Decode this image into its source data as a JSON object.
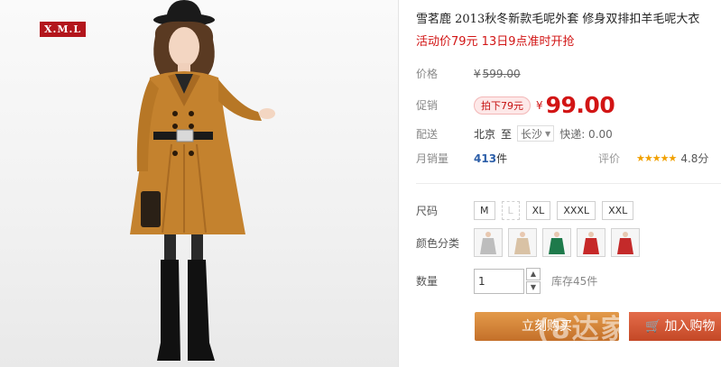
{
  "brand": {
    "logo_text": "X.M.L"
  },
  "product": {
    "title_prefix": "雪茗鹿 ",
    "title_year": "2013",
    "title_rest": "秋冬新款毛呢外套 修身双排扣羊毛呢大衣",
    "promo": "活动价79元 13日9点准时开抢"
  },
  "price_row": {
    "label": "价格",
    "symbol": "¥",
    "original": "599.00"
  },
  "promo_row": {
    "label": "促销",
    "badge": "拍下79元",
    "symbol": "¥",
    "price": "99.00"
  },
  "delivery": {
    "label": "配送",
    "from": "北京",
    "to_word": "至",
    "destination": "长沙",
    "shipping": "快递: 0.00"
  },
  "sales": {
    "label": "月销量",
    "count": "413",
    "unit": "件",
    "rating_label": "评价",
    "stars": "★★★★★",
    "score": "4.8分"
  },
  "sizes": {
    "label": "尺码",
    "options": [
      "M",
      "L",
      "XL",
      "XXXL",
      "XXL"
    ]
  },
  "colors": {
    "label": "颜色分类",
    "swatches": [
      {
        "icon": "coat-swatch-icon",
        "color": "#bdbdbd"
      },
      {
        "icon": "coat-swatch-icon",
        "color": "#d9c2a5"
      },
      {
        "icon": "coat-swatch-icon",
        "color": "#1e7a4b"
      },
      {
        "icon": "coat-swatch-icon",
        "color": "#c62828"
      },
      {
        "icon": "coat-swatch-icon",
        "color": "#c42a2a"
      }
    ]
  },
  "quantity": {
    "label": "数量",
    "value": "1",
    "up": "▲",
    "down": "▼",
    "stock": "库存45件"
  },
  "actions": {
    "buy_now": "立刻购买",
    "add_to_cart": "加入购物",
    "cart_icon": "🛒"
  },
  "watermark": "(8达家",
  "colors_theme": {
    "accent_red": "#d21515",
    "buy_orange": "#c4702a",
    "link_blue": "#2c5ea8",
    "star_gold": "#f1a000"
  }
}
